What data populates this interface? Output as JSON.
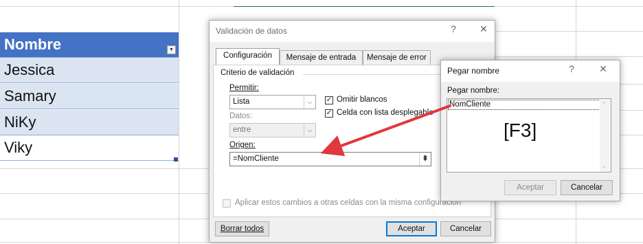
{
  "sheet": {
    "header": "Nombre",
    "rows": [
      "Jessica",
      "Samary",
      "NiKy",
      "Viky"
    ]
  },
  "validation_dialog": {
    "title": "Validación de datos",
    "help_glyph": "?",
    "close_glyph": "✕",
    "tabs": [
      "Configuración",
      "Mensaje de entrada",
      "Mensaje de error"
    ],
    "criteria_label": "Criterio de validación",
    "allow_label": "Permitir:",
    "allow_value": "Lista",
    "data_label": "Datos:",
    "data_value": "entre",
    "ignore_blank_label": "Omitir blancos",
    "in_cell_dropdown_label": "Celda con lista desplegable",
    "source_label": "Origen:",
    "source_value": "=NomCliente",
    "apply_all_label": "Aplicar estos cambios a otras celdas con la misma configuración",
    "clear_all_button": "Borrar todos",
    "ok_button": "Aceptar",
    "cancel_button": "Cancelar"
  },
  "paste_name_dialog": {
    "title": "Pegar nombre",
    "help_glyph": "?",
    "close_glyph": "✕",
    "list_label": "Pegar nombre:",
    "items": [
      "NomCliente"
    ],
    "hint": "[F3]",
    "ok_button": "Aceptar",
    "cancel_button": "Cancelar"
  },
  "colors": {
    "header_fill": "#4472c4",
    "row_fill": "#dbe5f1",
    "arrow": "#e0383e",
    "accent": "#0078d7"
  }
}
